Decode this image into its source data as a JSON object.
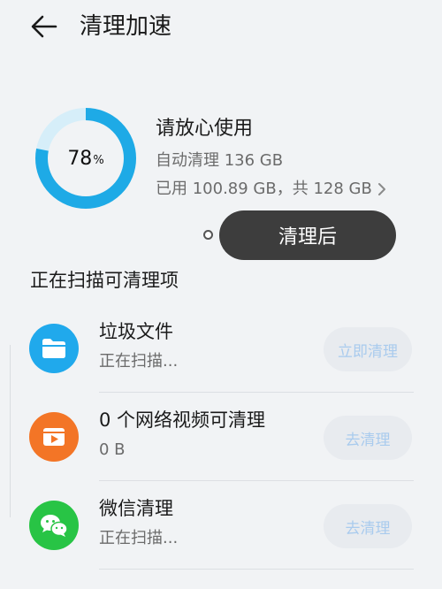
{
  "header": {
    "title": "清理加速"
  },
  "summary": {
    "percent_value": "78",
    "percent_unit": "%",
    "percent_fraction": 0.78,
    "status_title": "请放心使用",
    "auto_clean": "自动清理 136 GB",
    "usage": "已用 100.89 GB，共 128 GB",
    "ring_color": "#1eaae6",
    "ring_track_color": "#d6eef9"
  },
  "tooltip": {
    "label": "清理后"
  },
  "section": {
    "title": "正在扫描可清理项"
  },
  "items": [
    {
      "title": "垃圾文件",
      "subtitle": "正在扫描...",
      "button": "立即清理",
      "icon": "folder-icon",
      "color": "#20a9ec"
    },
    {
      "title": "0 个网络视频可清理",
      "subtitle": "0 B",
      "button": "去清理",
      "icon": "video-icon",
      "color": "#f37526"
    },
    {
      "title": "微信清理",
      "subtitle": "正在扫描...",
      "button": "去清理",
      "icon": "wechat-icon",
      "color": "#28c445"
    }
  ]
}
